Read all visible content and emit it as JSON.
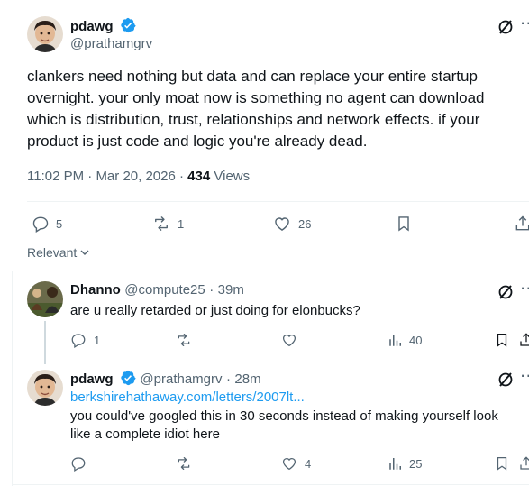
{
  "main_post": {
    "author_name": "pdawg",
    "author_handle": "@prathamgrv",
    "text": "clankers need nothing but data and can replace your entire startup overnight. your only moat now is something no agent can download which is distribution, trust, relationships and network effects. if your product is just code and logic you're already dead.",
    "time": "11:02 PM",
    "date": "Mar 20, 2026",
    "views_count": "434",
    "views_label": "Views",
    "replies": "5",
    "reposts": "1",
    "likes": "26"
  },
  "sort": {
    "label": "Relevant"
  },
  "replies": [
    {
      "author_name": "Dhanno",
      "author_handle": "@compute25",
      "time_ago": "39m",
      "text": "are u really retarded or just doing for elonbucks?",
      "replies": "1",
      "reposts": "",
      "likes": "",
      "views": "40"
    },
    {
      "author_name": "pdawg",
      "author_handle": "@prathamgrv",
      "time_ago": "28m",
      "link": "berkshirehathaway.com/letters/2007lt...",
      "text": "you could've googled this in 30 seconds instead of making yourself look like a complete idiot here",
      "replies": "",
      "reposts": "",
      "likes": "4",
      "views": "25"
    }
  ],
  "separators": {
    "dot": "·"
  },
  "colors": {
    "verified": "#1d9bf0",
    "text": "#0f1419",
    "muted": "#536471",
    "link": "#1d9bf0",
    "divider": "#eff3f4"
  }
}
